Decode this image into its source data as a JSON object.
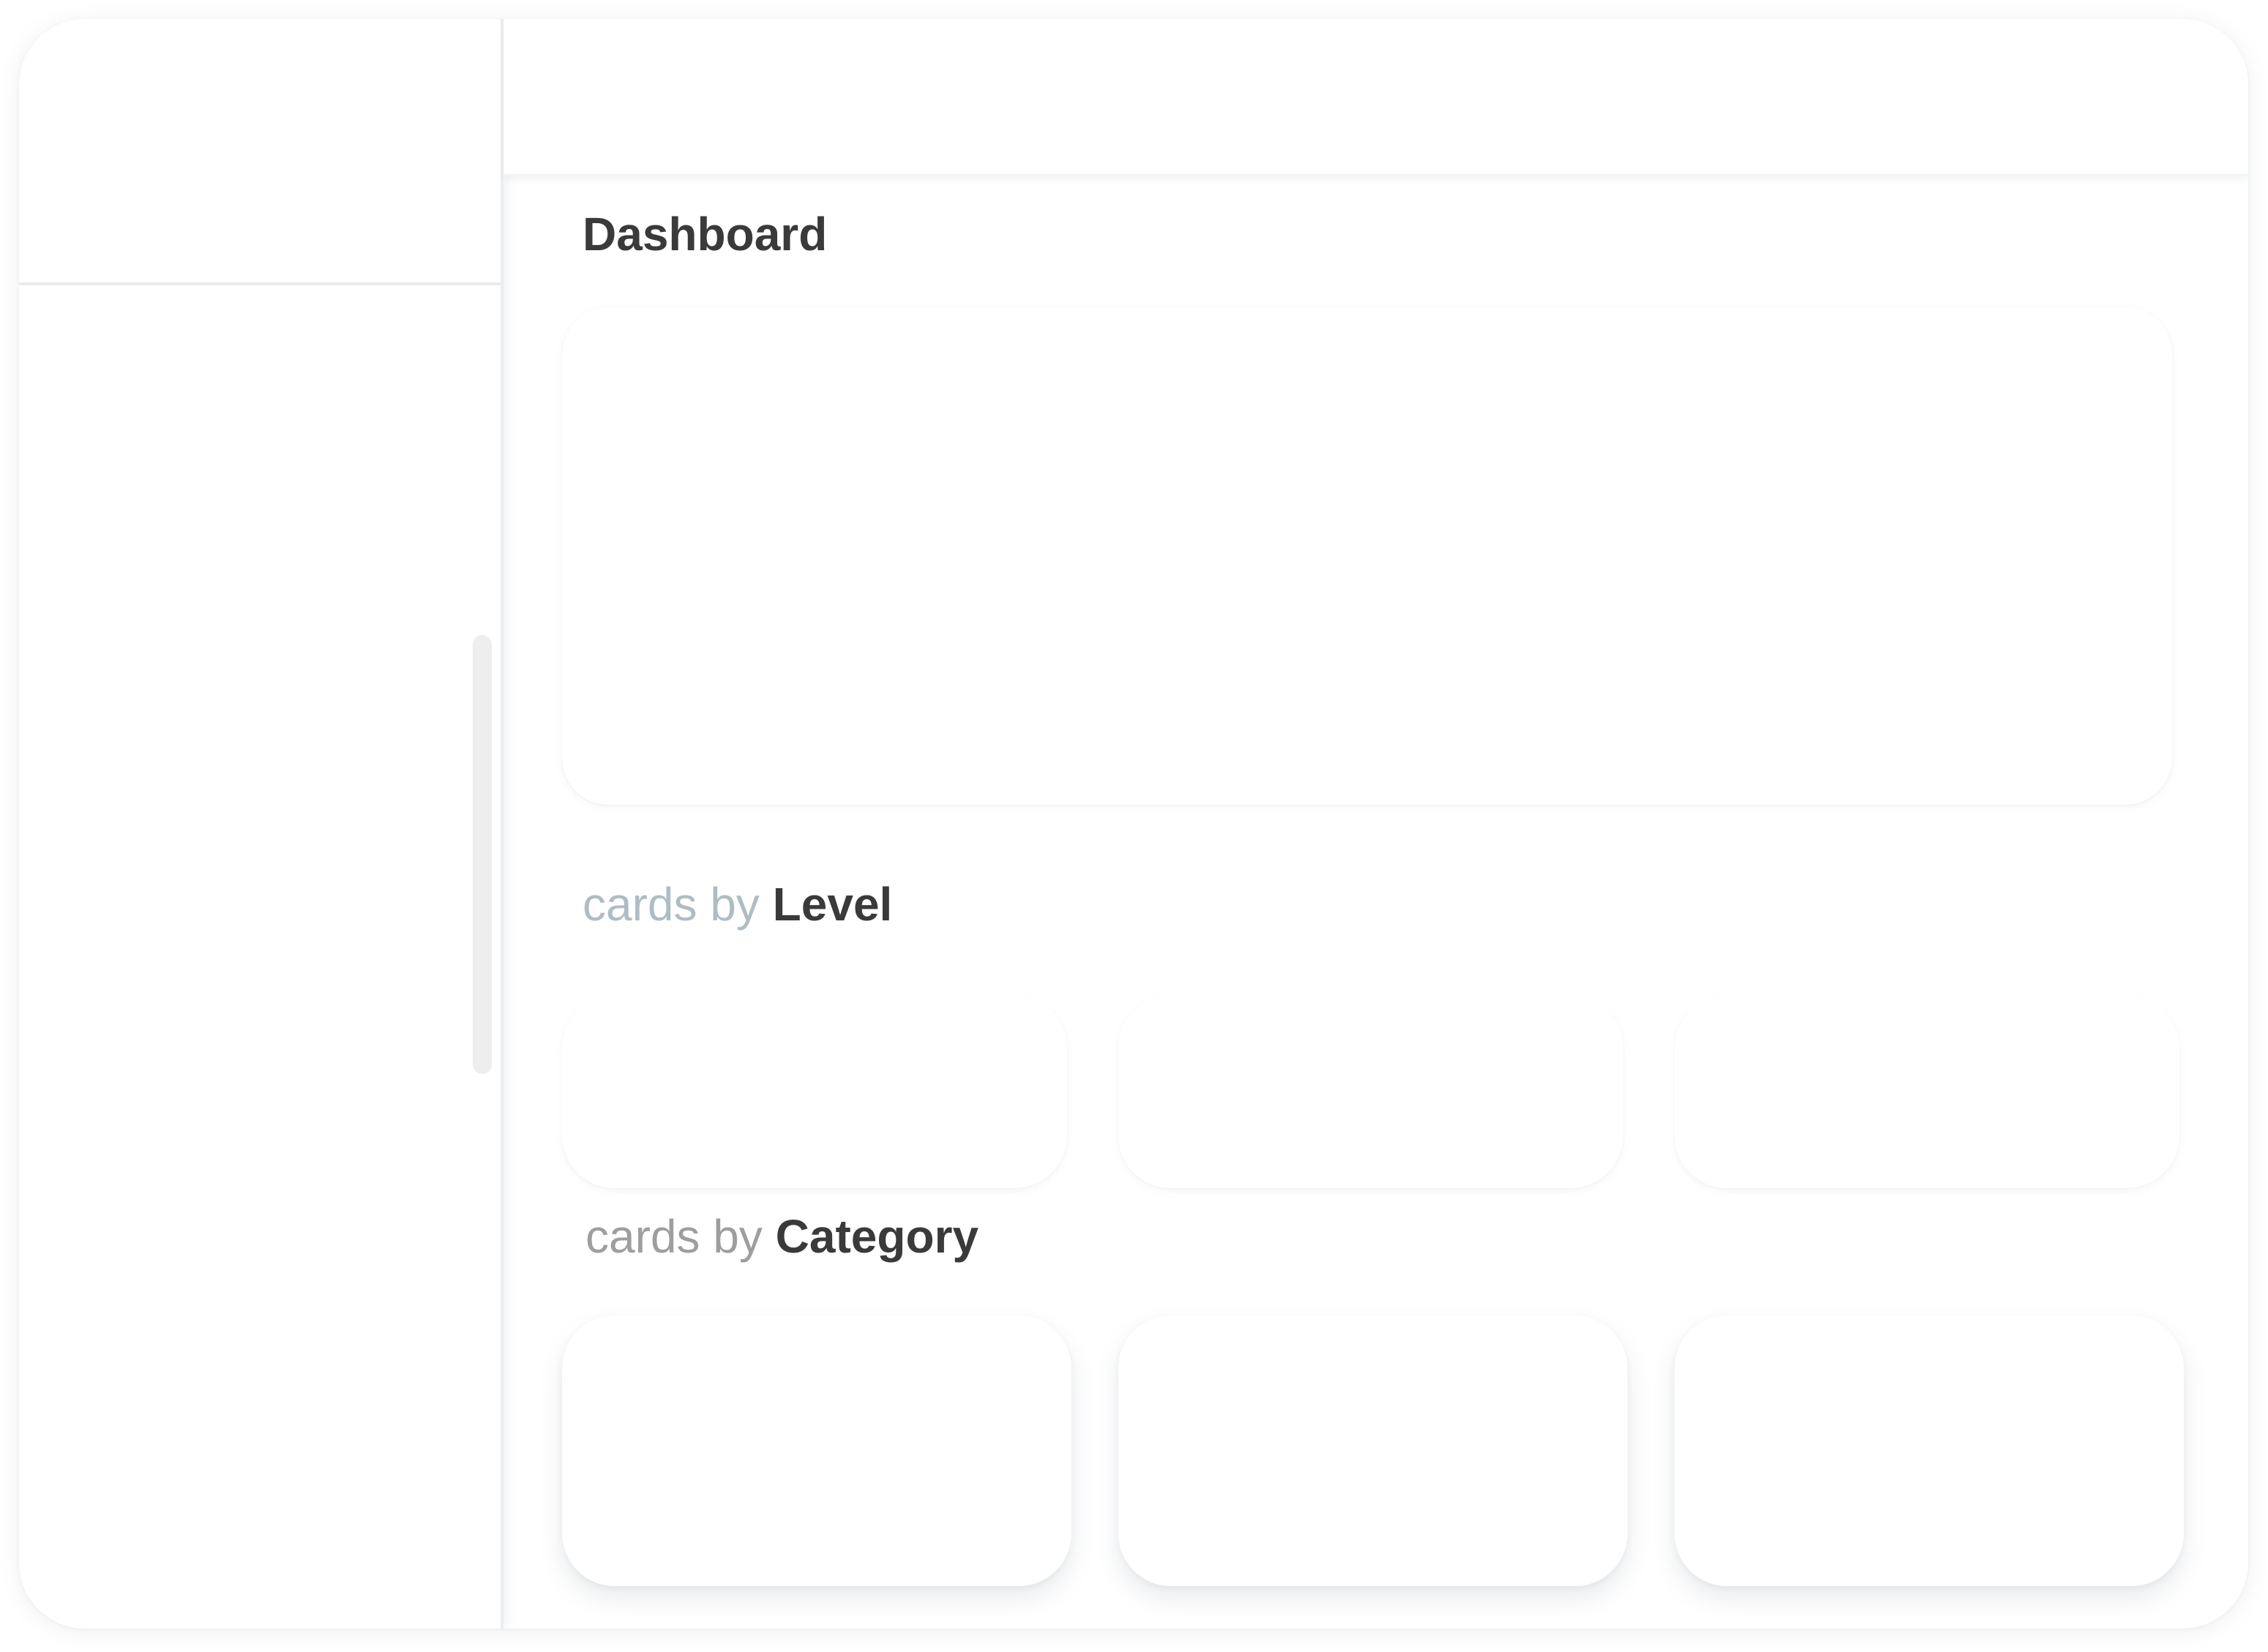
{
  "main": {
    "title": "Dashboard",
    "sections": {
      "level": {
        "prefix": "cards by",
        "label": "Level"
      },
      "category": {
        "prefix": "cards by",
        "label": "Category"
      }
    }
  }
}
